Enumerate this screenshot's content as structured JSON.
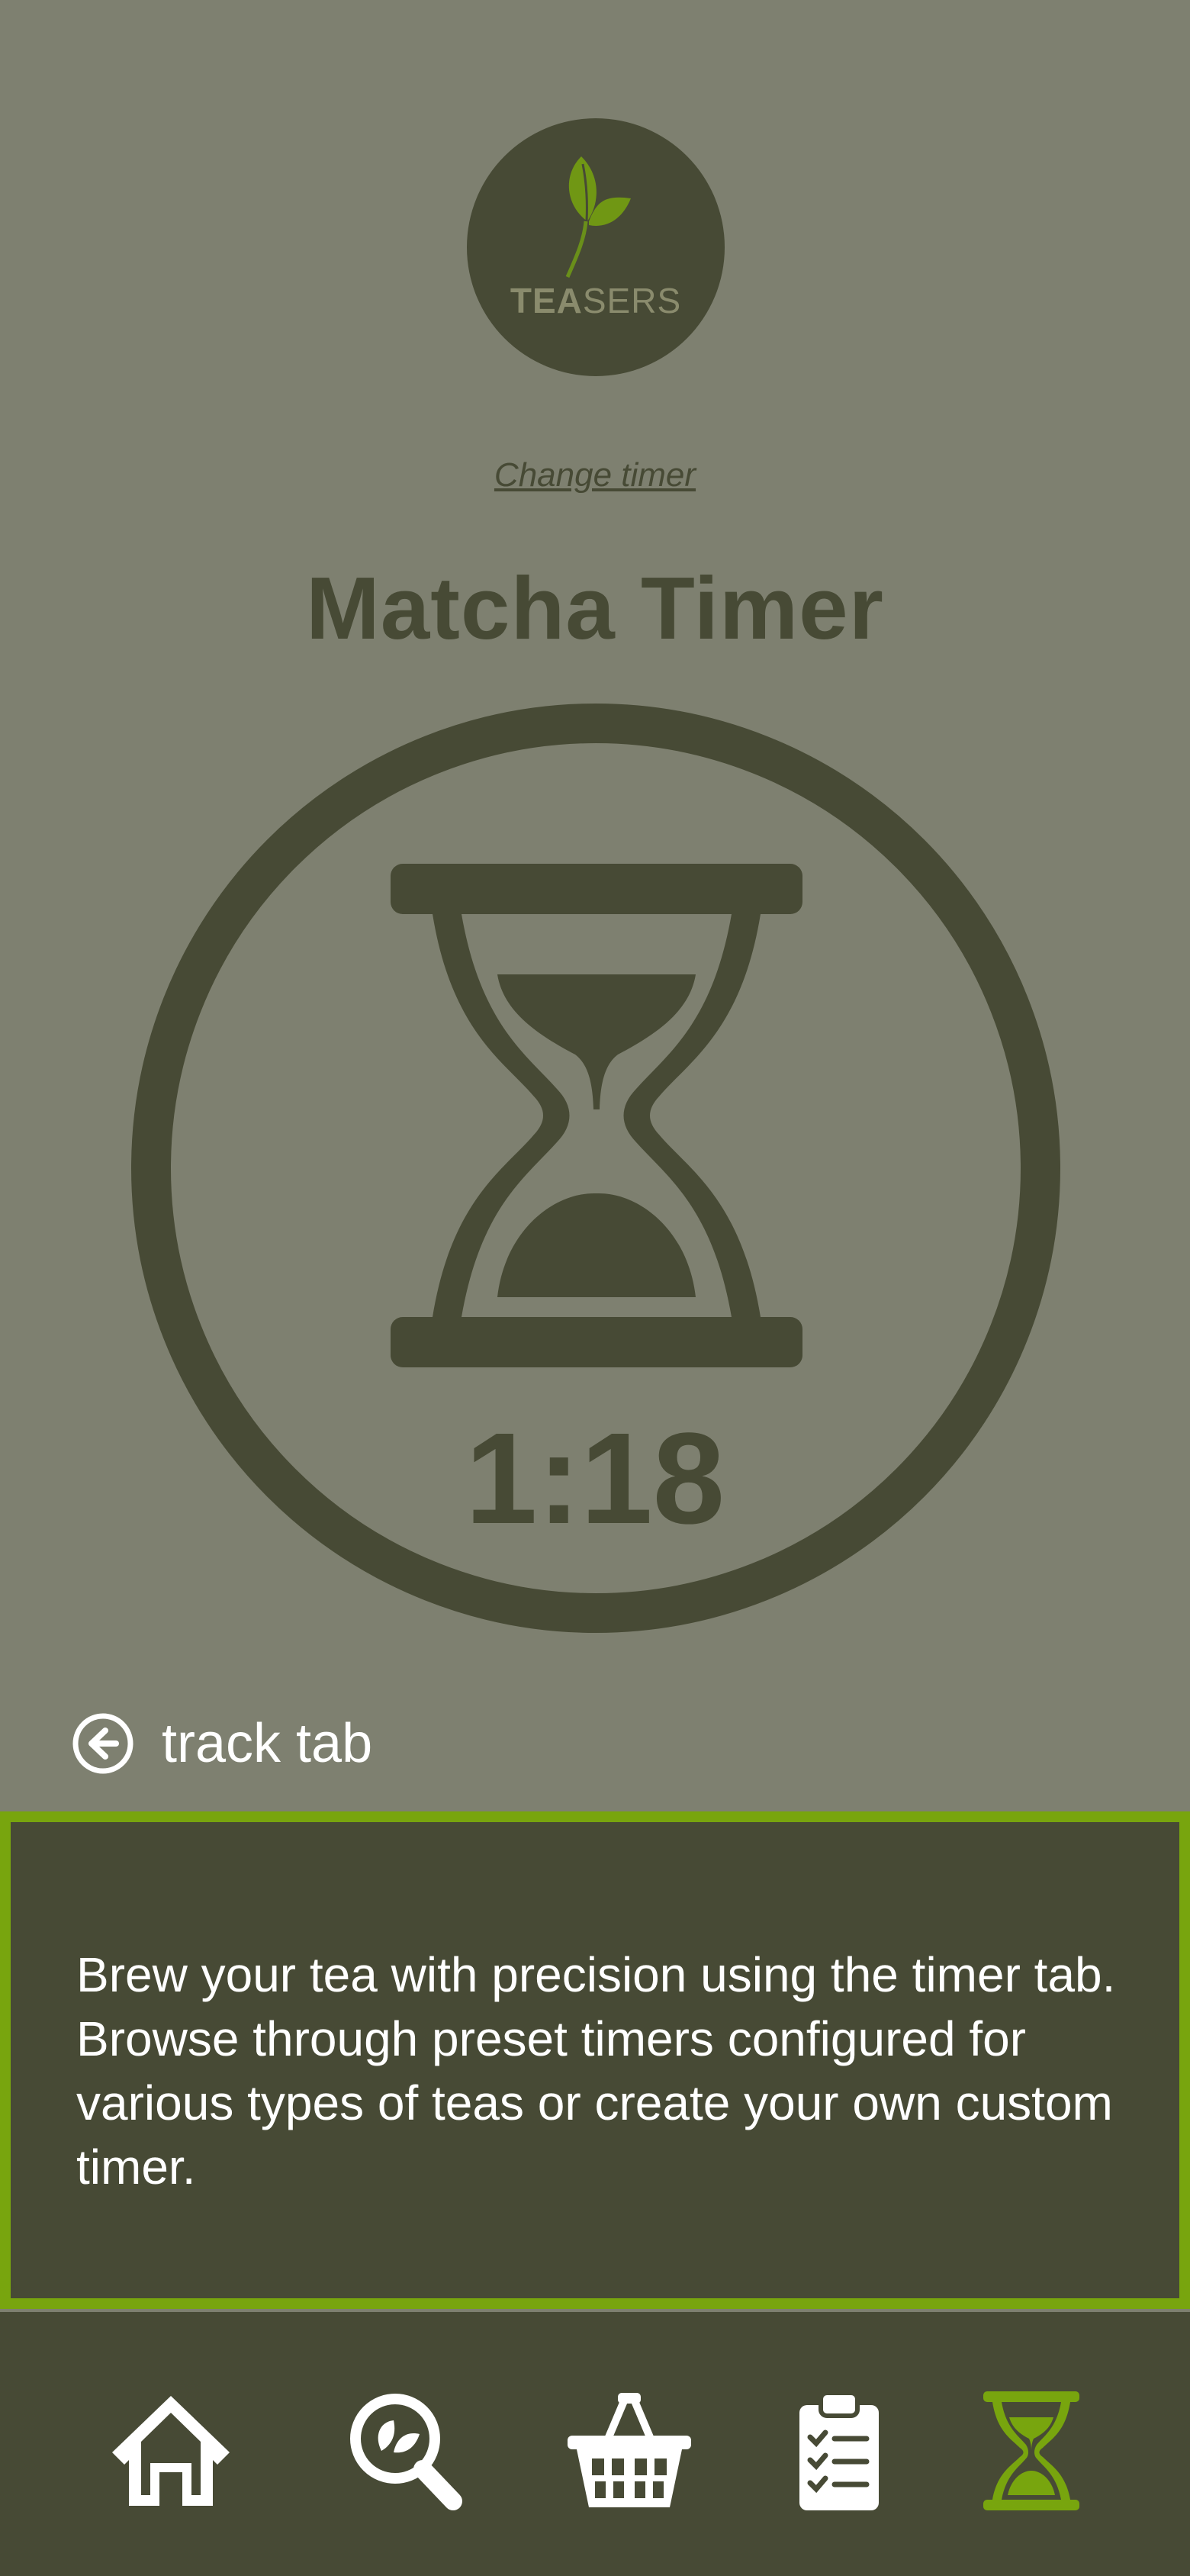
{
  "logo": {
    "brand_part1": "TEA",
    "brand_part2": "SERS"
  },
  "header": {
    "change_timer_link": "Change timer",
    "title": "Matcha Timer"
  },
  "timer": {
    "time_display": "1:18",
    "icon": "hourglass-icon"
  },
  "track_tab": {
    "label": "track tab",
    "icon": "back-arrow-circle-icon"
  },
  "info": {
    "text": "Brew your tea with precision using the timer tab. Browse through preset timers configured for various types of teas or create your own custom timer."
  },
  "bottom_nav": {
    "items": [
      {
        "name": "home",
        "icon": "home-icon",
        "active": false
      },
      {
        "name": "search",
        "icon": "search-leaf-icon",
        "active": false
      },
      {
        "name": "shop",
        "icon": "basket-icon",
        "active": false
      },
      {
        "name": "log",
        "icon": "clipboard-checklist-icon",
        "active": false
      },
      {
        "name": "timer",
        "icon": "hourglass-icon",
        "active": true
      }
    ]
  },
  "colors": {
    "background": "#7e8070",
    "dark": "#474a35",
    "accent": "#78a50e",
    "white": "#ffffff"
  }
}
